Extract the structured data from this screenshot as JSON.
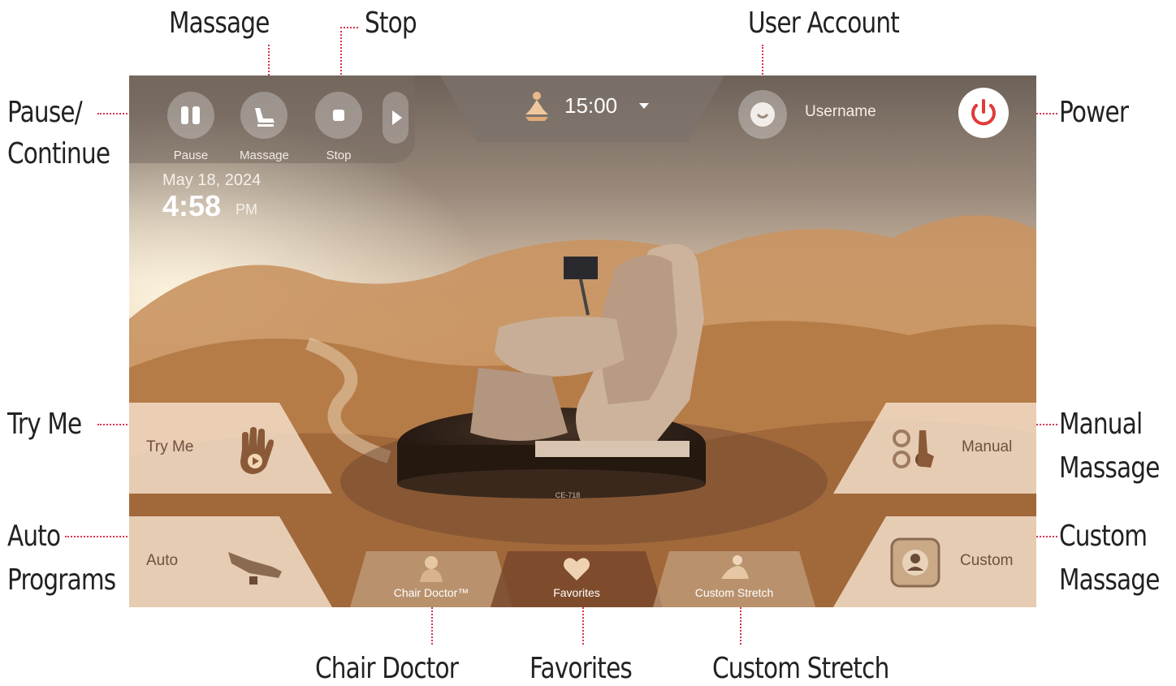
{
  "callouts": {
    "massage": "Massage",
    "stop": "Stop",
    "user_account": "User Account",
    "pause_line1": "Pause/",
    "pause_line2": "Continue",
    "power": "Power",
    "try_me": "Try Me",
    "auto_line1": "Auto",
    "auto_line2": "Programs",
    "manual_line1": "Manual",
    "manual_line2": "Massage",
    "custom_line1": "Custom",
    "custom_line2": "Massage",
    "chair_doctor": "Chair Doctor",
    "favorites": "Favorites",
    "custom_stretch": "Custom Stretch"
  },
  "screen": {
    "controls": {
      "pause_label": "Pause",
      "massage_label": "Massage",
      "stop_label": "Stop"
    },
    "timer": {
      "value": "15:00"
    },
    "user": {
      "name": "Username"
    },
    "clock": {
      "date": "May 18, 2024",
      "time": "4:58",
      "ampm": "PM"
    },
    "tiles": {
      "try_me": "Try Me",
      "auto": "Auto",
      "manual": "Manual",
      "custom": "Custom"
    },
    "bottom_tabs": {
      "chair_doctor": "Chair Doctor™",
      "favorites": "Favorites",
      "custom_stretch": "Custom Stretch"
    },
    "model_label": "CE-718"
  },
  "colors": {
    "accent_callout_line": "#d8354a",
    "power_icon": "#e03a3a"
  }
}
